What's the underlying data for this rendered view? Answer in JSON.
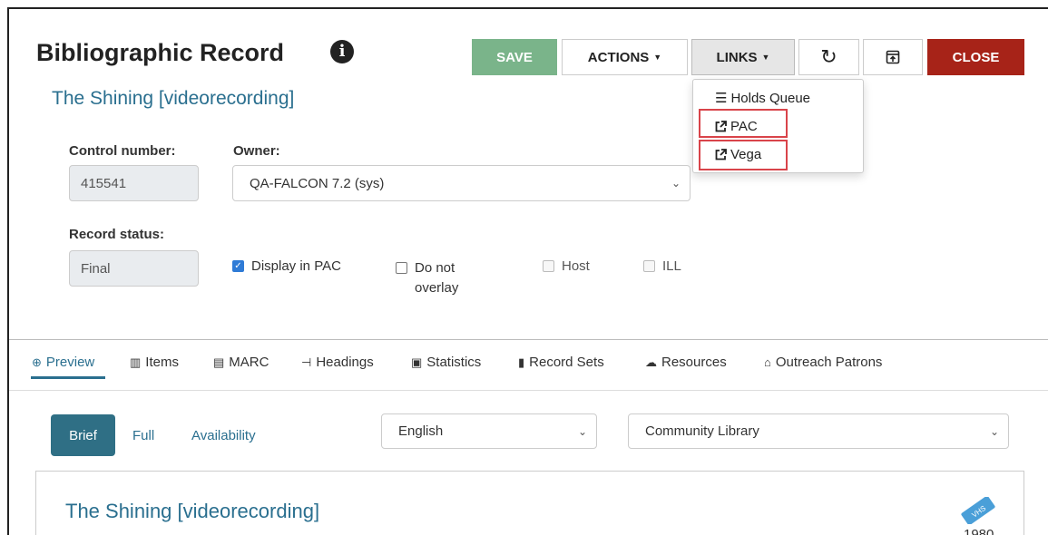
{
  "header": {
    "title": "Bibliographic Record",
    "info_icon": "i"
  },
  "toolbar": {
    "save_label": "SAVE",
    "actions_label": "ACTIONS",
    "links_label": "LINKS",
    "refresh_icon": "refresh-icon",
    "popout_icon": "popout-icon",
    "close_label": "CLOSE",
    "colors": {
      "save": "#7ab48a",
      "close": "#a72318"
    }
  },
  "links_menu": {
    "items": [
      {
        "label": "Holds Queue",
        "icon": "list-ordered-icon"
      },
      {
        "label": "PAC",
        "icon": "external-link-icon"
      },
      {
        "label": "Vega",
        "icon": "external-link-icon"
      }
    ]
  },
  "record": {
    "title": "The Shining [videorecording]",
    "control_number_label": "Control number:",
    "control_number": "415541",
    "owner_label": "Owner:",
    "owner_value": "QA-FALCON 7.2 (sys)",
    "record_status_label": "Record status:",
    "record_status": "Final"
  },
  "checkboxes": {
    "display_in_pac": {
      "label": "Display in PAC",
      "checked": true
    },
    "do_not_overlay": {
      "label_line1": "Do not",
      "label_line2": "overlay",
      "checked": false
    },
    "host": {
      "label": "Host",
      "checked": false,
      "disabled": true
    },
    "ill": {
      "label": "ILL",
      "checked": false,
      "disabled": true
    }
  },
  "tabs": [
    {
      "label": "Preview",
      "icon": "globe-icon",
      "active": true
    },
    {
      "label": "Items",
      "icon": "books-icon"
    },
    {
      "label": "MARC",
      "icon": "keyboard-icon"
    },
    {
      "label": "Headings",
      "icon": "sitemap-icon"
    },
    {
      "label": "Statistics",
      "icon": "bar-chart-icon"
    },
    {
      "label": "Record Sets",
      "icon": "clipboard-icon"
    },
    {
      "label": "Resources",
      "icon": "cloud-icon"
    },
    {
      "label": "Outreach Patrons",
      "icon": "home-icon"
    }
  ],
  "preview": {
    "view_modes": [
      "Brief",
      "Full",
      "Availability"
    ],
    "language": "English",
    "library": "Community Library",
    "card_title": "The Shining [videorecording]",
    "badge_text": "VHS",
    "year": "1980"
  }
}
